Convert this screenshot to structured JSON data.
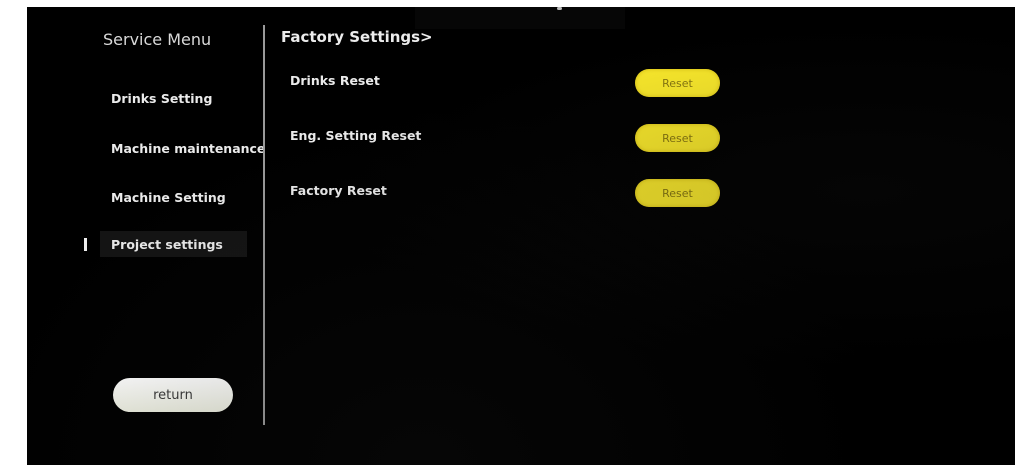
{
  "sidebar": {
    "title": "Service Menu",
    "items": [
      {
        "label": "Drinks Setting",
        "selected": false
      },
      {
        "label": "Machine maintenance",
        "selected": false
      },
      {
        "label": "Machine Setting",
        "selected": false
      },
      {
        "label": "Project settings",
        "selected": true
      }
    ],
    "return_label": "return"
  },
  "main": {
    "title": "Factory Settings>",
    "settings": [
      {
        "label": "Drinks Reset",
        "button_label": "Reset"
      },
      {
        "label": "Eng. Setting Reset",
        "button_label": "Reset"
      },
      {
        "label": "Factory Reset",
        "button_label": "Reset"
      }
    ]
  },
  "colors": {
    "background": "#000000",
    "reset_button": "#ffee2c",
    "reset_button_text": "#8a7a10",
    "return_button": "#f5f6ec",
    "text": "#ebebeb",
    "divider": "#9a9a9a"
  },
  "icons": {
    "selection_indicator": "vertical-bar"
  }
}
